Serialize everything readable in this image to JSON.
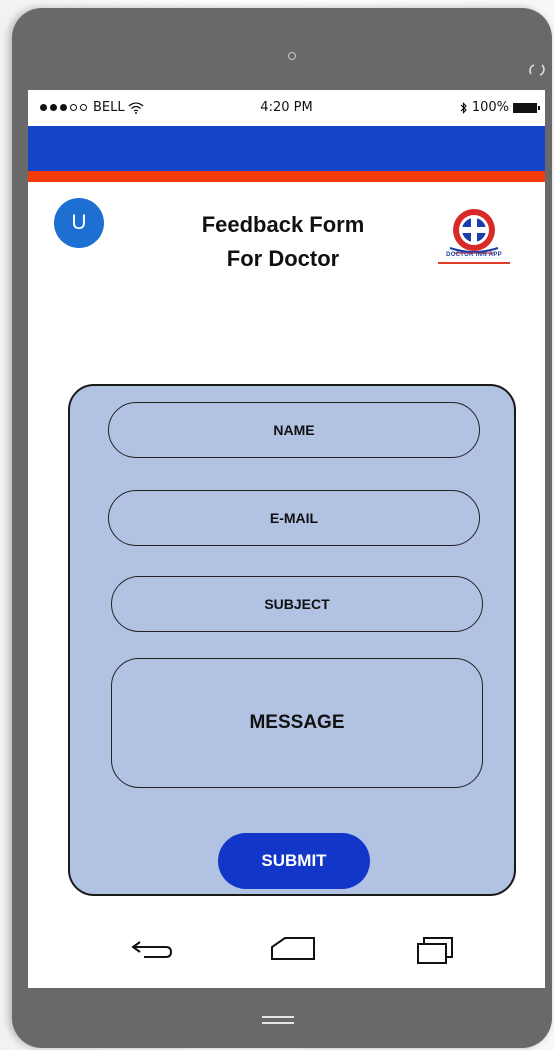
{
  "status_bar": {
    "carrier": "BELL",
    "time": "4:20 PM",
    "battery": "100%"
  },
  "header": {
    "avatar_letter": "U",
    "title_line1": "Feedback Form",
    "title_line2": "For Doctor",
    "logo_caption": "DOCTOR INN APP"
  },
  "form": {
    "name_label": "NAME",
    "email_label": "E-MAIL",
    "subject_label": "SUBJECT",
    "message_label": "MESSAGE",
    "submit_label": "SUBMIT"
  },
  "colors": {
    "blue_bar": "#1644c7",
    "red_bar": "#f23a0a",
    "form_background": "#b2c2e3",
    "submit_button": "#1236c8",
    "avatar": "#1e6fd2"
  },
  "icons": [
    "wifi-icon",
    "bluetooth-icon",
    "battery-icon",
    "rotate-icon",
    "back-icon",
    "home-icon",
    "recent-apps-icon",
    "menu-icon"
  ]
}
